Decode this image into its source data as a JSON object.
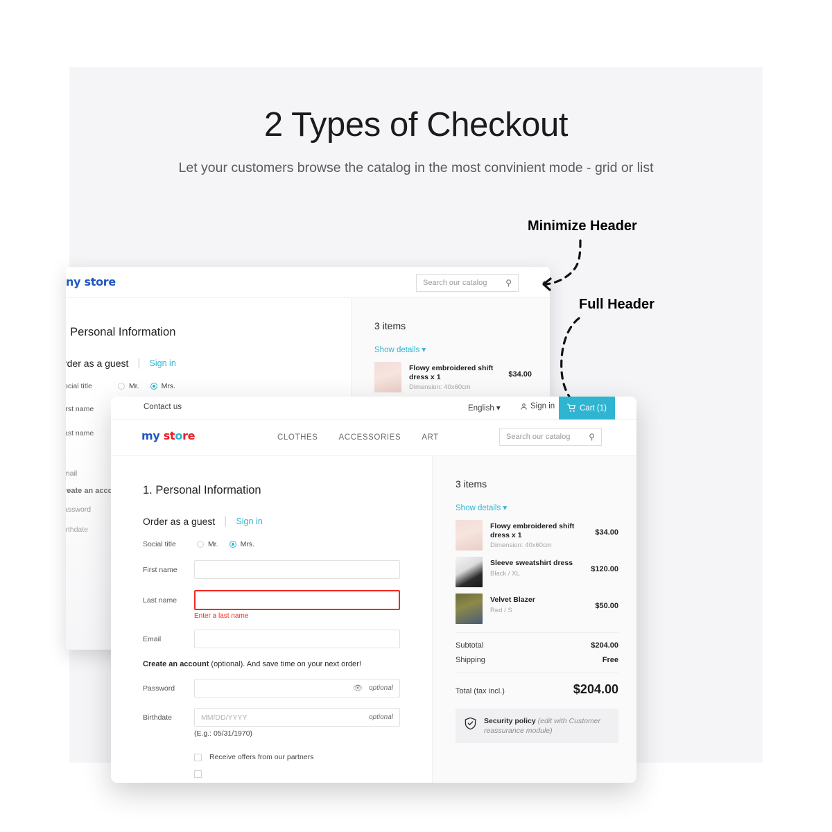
{
  "hero": {
    "title": "2 Types of Checkout",
    "subtitle": "Let your customers browse the catalog in the most convinient mode - grid or list"
  },
  "annotations": {
    "minimize_header": "Minimize Header",
    "full_header": "Full Header"
  },
  "colors": {
    "accent": "#2fb5d2",
    "error": "#f4291f",
    "logo_blue": "#1f57c3",
    "logo_red": "#ea2027",
    "panel_bg": "#f5f5f7"
  },
  "topbar": {
    "contact": "Contact us",
    "language": "English",
    "language_caret": "▾",
    "sign_in": "Sign in",
    "cart": "Cart (1)"
  },
  "mainbar": {
    "logo_part1": "my",
    "logo_part2": "st",
    "logo_part3": "o",
    "logo_part4": "re",
    "nav": [
      "CLOTHES",
      "ACCESSORIES",
      "ART"
    ],
    "search_placeholder": "Search our catalog"
  },
  "minimized_header": {
    "logo_visible": "ny store",
    "search_placeholder": "Search our catalog",
    "collapse_glyph": "‹"
  },
  "checkout": {
    "step_title": "1. Personal Information",
    "guest_label": "Order as a guest",
    "divider": "|",
    "sign_in_link": "Sign in",
    "social_title_label": "Social title",
    "social_options": [
      "Mr.",
      "Mrs."
    ],
    "social_selected": "Mrs.",
    "first_name_label": "First name",
    "first_name_value": "",
    "last_name_label": "Last name",
    "last_name_value": "",
    "last_name_error": "Enter a last name",
    "email_label": "Email",
    "email_value": "",
    "create_account_bold": "Create an account",
    "create_account_rest": " (optional). And save time on your next order!",
    "password_label": "Password",
    "password_optional": "optional",
    "birthdate_label": "Birthdate",
    "birthdate_placeholder": "MM/DD/YYYY",
    "birthdate_optional": "optional",
    "birthdate_example": "(E.g.: 05/31/1970)",
    "offers_checkbox": "Receive offers from our partners"
  },
  "back_window": {
    "step_title": ". Personal Information",
    "guest_label": "rder as a guest",
    "sign_in_link": "Sign in",
    "social_title_label": "ocial title",
    "social_options": [
      "Mr.",
      "Mrs."
    ],
    "first_name_label": "irst name",
    "last_name_label": "ast name",
    "email_label": "mail",
    "create_account_label": "reate an accou",
    "password_label": "assword",
    "birthdate_label": "irthdate"
  },
  "cart": {
    "items_count": "3 items",
    "show_details": "Show details",
    "show_details_caret": "▾",
    "products": [
      {
        "name": "Flowy embroidered shift dress x 1",
        "attr": "Dimension: 40x60cm",
        "price": "$34.00"
      },
      {
        "name": "Sleeve sweatshirt dress",
        "attr": "Black / XL",
        "price": "$120.00"
      },
      {
        "name": "Velvet Blazer",
        "attr": "Red / S",
        "price": "$50.00"
      }
    ],
    "subtotal_label": "Subtotal",
    "subtotal_value": "$204.00",
    "shipping_label": "Shipping",
    "shipping_value": "Free",
    "total_label": "Total (tax incl.)",
    "total_value": "$204.00",
    "security_bold": "Security policy",
    "security_italic": " (edit with Customer reassurance module)"
  }
}
